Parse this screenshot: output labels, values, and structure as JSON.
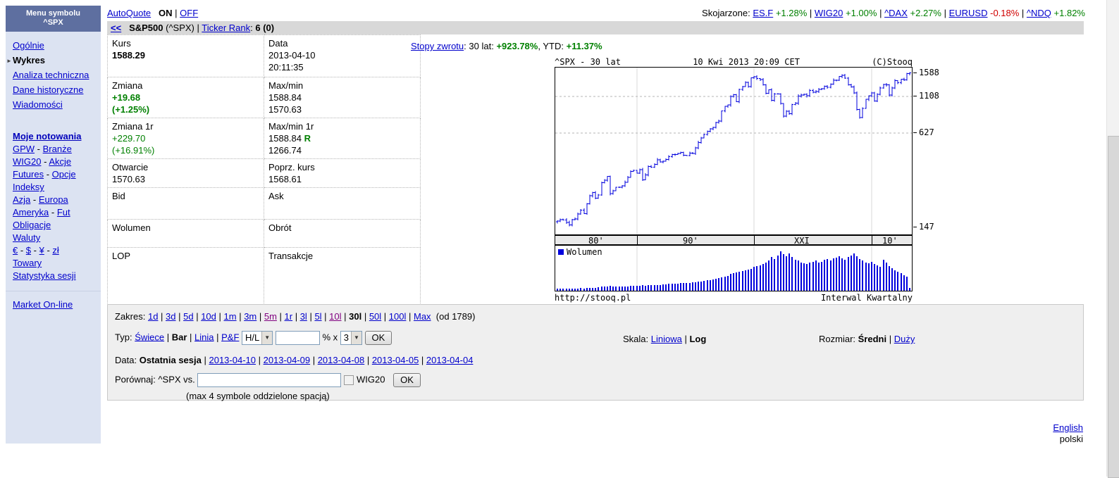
{
  "sidebar": {
    "header_line1": "Menu symbolu",
    "header_line2": "^SPX",
    "top_items": [
      {
        "label": "Ogólnie",
        "state": "link"
      },
      {
        "label": "Wykres",
        "state": "current"
      },
      {
        "label": "Analiza techniczna",
        "state": "link"
      },
      {
        "label": "Dane historyczne",
        "state": "link"
      },
      {
        "label": "Wiadomości",
        "state": "link"
      }
    ],
    "groups": [
      {
        "parts": [
          {
            "t": "Moje notowania",
            "link": true,
            "bold": true
          }
        ]
      },
      {
        "parts": [
          {
            "t": "GPW",
            "link": true
          },
          {
            "t": " - "
          },
          {
            "t": "Branże",
            "link": true
          }
        ]
      },
      {
        "parts": [
          {
            "t": "WIG20",
            "link": true
          },
          {
            "t": " - "
          },
          {
            "t": "Akcje",
            "link": true
          }
        ]
      },
      {
        "parts": [
          {
            "t": "Futures",
            "link": true
          },
          {
            "t": " - "
          },
          {
            "t": "Opcje",
            "link": true
          }
        ]
      },
      {
        "parts": [
          {
            "t": "Indeksy",
            "link": true
          }
        ]
      },
      {
        "parts": [
          {
            "t": "Azja",
            "link": true
          },
          {
            "t": " - "
          },
          {
            "t": "Europa",
            "link": true
          }
        ]
      },
      {
        "parts": [
          {
            "t": "Ameryka",
            "link": true
          },
          {
            "t": " - "
          },
          {
            "t": "Fut",
            "link": true
          }
        ]
      },
      {
        "parts": [
          {
            "t": "Obligacje",
            "link": true
          }
        ]
      },
      {
        "parts": [
          {
            "t": "Waluty",
            "link": true
          }
        ]
      },
      {
        "parts": [
          {
            "t": "€",
            "link": true
          },
          {
            "t": " - "
          },
          {
            "t": "$",
            "link": true
          },
          {
            "t": " - "
          },
          {
            "t": "¥",
            "link": true
          },
          {
            "t": " - "
          },
          {
            "t": "zł",
            "link": true
          }
        ]
      },
      {
        "parts": [
          {
            "t": "Towary",
            "link": true
          }
        ]
      },
      {
        "parts": [
          {
            "t": "Statystyka sesji",
            "link": true
          }
        ]
      }
    ],
    "bottom_item": "Market On-line"
  },
  "topbar": {
    "autoquote_label": "AutoQuote",
    "on_label": "ON",
    "off_label": "OFF",
    "related_label": "Skojarzone:",
    "related": [
      {
        "symbol": "ES.F",
        "change": "+1.28%",
        "direction": "up"
      },
      {
        "symbol": "WIG20",
        "change": "+1.00%",
        "direction": "up"
      },
      {
        "symbol": "^DAX",
        "change": "+2.27%",
        "direction": "up"
      },
      {
        "symbol": "EURUSD",
        "change": "-0.18%",
        "direction": "down"
      },
      {
        "symbol": "^NDQ",
        "change": "+1.82%",
        "direction": "up"
      }
    ]
  },
  "titlebar": {
    "back": "<<",
    "name": "S&P500",
    "code": "(^SPX)",
    "rank_label": "Ticker Rank",
    "rank_value": "6 (0)"
  },
  "quote_table": {
    "kurs": {
      "label": "Kurs",
      "value": "1588.29"
    },
    "data": {
      "label": "Data",
      "line1": "2013-04-10",
      "line2": "20:11:35"
    },
    "zmiana": {
      "label": "Zmiana",
      "line1": "+19.68",
      "line2": "(+1.25%)"
    },
    "maxmin": {
      "label": "Max/min",
      "line1": "1588.84",
      "line2": "1570.63"
    },
    "zmiana1r": {
      "label": "Zmiana 1r",
      "line1": "+229.70",
      "line2": "(+16.91%)"
    },
    "maxmin1r": {
      "label": "Max/min 1r",
      "line1": "1588.84",
      "flag": "R",
      "line2": "1266.74"
    },
    "otwarcie": {
      "label": "Otwarcie",
      "value": "1570.63"
    },
    "poprz": {
      "label": "Poprz. kurs",
      "value": "1568.61"
    },
    "bid": {
      "label": "Bid"
    },
    "ask": {
      "label": "Ask"
    },
    "wolumen": {
      "label": "Wolumen"
    },
    "obrot": {
      "label": "Obrót"
    },
    "lop": {
      "label": "LOP"
    },
    "transakcje": {
      "label": "Transakcje"
    }
  },
  "returns": {
    "link_label": "Stopy zwrotu",
    "period_label": "30 lat:",
    "period_value": "+923.78%",
    "ytd_label": "YTD:",
    "ytd_value": "+11.37%"
  },
  "chart_data": {
    "type": "ohlc-with-volume",
    "title": "^SPX - 30 lat",
    "timestamp": "10 Kwi 2013 20:09 CET",
    "copyright": "(C)Stooq",
    "legend": "Wolumen",
    "source": "http://stooq.pl",
    "interval_label": "Interwal Kwartalny",
    "scale": "log",
    "x_range": [
      "1983Q2",
      "2013Q2"
    ],
    "y_ticks": [
      1588,
      1108,
      627,
      147
    ],
    "ylim": [
      147,
      1650
    ],
    "x_labels": [
      "80'",
      "90'",
      "XXI",
      "10'"
    ],
    "x_label_bar_index": [
      13,
      45,
      83,
      113
    ],
    "decade_gridline_bar_index": [
      27,
      67,
      107
    ],
    "h_gridlines": [
      1108,
      627
    ],
    "quarterly_closes": [
      162,
      166,
      165,
      159,
      153,
      166,
      167,
      181,
      192,
      182,
      211,
      239,
      251,
      231,
      242,
      292,
      304,
      322,
      247,
      259,
      273,
      272,
      278,
      295,
      318,
      349,
      353,
      339,
      358,
      306,
      330,
      375,
      371,
      388,
      417,
      404,
      408,
      418,
      436,
      452,
      451,
      459,
      467,
      446,
      444,
      462,
      459,
      501,
      544,
      584,
      616,
      645,
      671,
      687,
      741,
      757,
      885,
      947,
      970,
      1102,
      1134,
      1017,
      1229,
      1286,
      1373,
      1283,
      1469,
      1499,
      1455,
      1436,
      1320,
      1160,
      1224,
      1041,
      1148,
      1147,
      990,
      815,
      880,
      848,
      975,
      996,
      1112,
      1126,
      1141,
      1115,
      1212,
      1181,
      1191,
      1229,
      1248,
      1295,
      1270,
      1336,
      1418,
      1421,
      1503,
      1527,
      1468,
      1323,
      1280,
      1166,
      903,
      798,
      919,
      1057,
      1115,
      1169,
      1031,
      1141,
      1258,
      1326,
      1321,
      1131,
      1258,
      1408,
      1362,
      1441,
      1426,
      1569,
      1588
    ],
    "volume_rel": [
      0.05,
      0.05,
      0.06,
      0.05,
      0.05,
      0.06,
      0.06,
      0.06,
      0.07,
      0.06,
      0.07,
      0.08,
      0.08,
      0.08,
      0.09,
      0.1,
      0.1,
      0.11,
      0.12,
      0.1,
      0.1,
      0.1,
      0.11,
      0.11,
      0.11,
      0.12,
      0.12,
      0.13,
      0.13,
      0.14,
      0.13,
      0.14,
      0.14,
      0.15,
      0.15,
      0.15,
      0.16,
      0.16,
      0.17,
      0.17,
      0.18,
      0.18,
      0.19,
      0.19,
      0.2,
      0.2,
      0.21,
      0.22,
      0.23,
      0.24,
      0.25,
      0.26,
      0.27,
      0.28,
      0.3,
      0.32,
      0.34,
      0.36,
      0.38,
      0.42,
      0.44,
      0.46,
      0.48,
      0.5,
      0.52,
      0.54,
      0.56,
      0.6,
      0.62,
      0.64,
      0.68,
      0.72,
      0.76,
      0.85,
      0.8,
      0.9,
      1.0,
      0.92,
      0.88,
      0.95,
      0.85,
      0.78,
      0.76,
      0.72,
      0.7,
      0.68,
      0.72,
      0.74,
      0.76,
      0.72,
      0.74,
      0.78,
      0.8,
      0.76,
      0.82,
      0.84,
      0.88,
      0.82,
      0.78,
      0.86,
      0.9,
      0.94,
      0.88,
      0.8,
      0.76,
      0.72,
      0.7,
      0.74,
      0.68,
      0.64,
      0.6,
      0.78,
      0.72,
      0.62,
      0.58,
      0.52,
      0.48,
      0.44,
      0.4,
      0.36,
      0.08
    ]
  },
  "controls": {
    "zakres_label": "Zakres:",
    "zakres_items": [
      {
        "label": "1d",
        "state": "link"
      },
      {
        "label": "3d",
        "state": "link"
      },
      {
        "label": "5d",
        "state": "link"
      },
      {
        "label": "10d",
        "state": "link"
      },
      {
        "label": "1m",
        "state": "link"
      },
      {
        "label": "3m",
        "state": "link"
      },
      {
        "label": "5m",
        "state": "visited"
      },
      {
        "label": "1r",
        "state": "link"
      },
      {
        "label": "3l",
        "state": "link"
      },
      {
        "label": "5l",
        "state": "link"
      },
      {
        "label": "10l",
        "state": "visited"
      },
      {
        "label": "30l",
        "state": "current"
      },
      {
        "label": "50l",
        "state": "link"
      },
      {
        "label": "100l",
        "state": "link"
      },
      {
        "label": "Max",
        "state": "link"
      }
    ],
    "zakres_suffix": "(od 1789)",
    "typ_label": "Typ:",
    "typ_items": [
      {
        "label": "Świece",
        "state": "link"
      },
      {
        "label": "Bar",
        "state": "current"
      },
      {
        "label": "Linia",
        "state": "link"
      },
      {
        "label": "P&F",
        "state": "link"
      }
    ],
    "hl_select_value": "H/L",
    "pct_input_value": "",
    "pct_label": "% x",
    "mult_select_value": "3",
    "ok_label": "OK",
    "skala_label": "Skala:",
    "skala_items": [
      {
        "label": "Liniowa",
        "state": "link"
      },
      {
        "label": "Log",
        "state": "current"
      }
    ],
    "rozmiar_label": "Rozmiar:",
    "rozmiar_items": [
      {
        "label": "Średni",
        "state": "current"
      },
      {
        "label": "Duży",
        "state": "link"
      }
    ],
    "data_label": "Data:",
    "data_current": "Ostatnia sesja",
    "date_links": [
      "2013-04-10",
      "2013-04-09",
      "2013-04-08",
      "2013-04-05",
      "2013-04-04"
    ],
    "compare_label": "Porównaj: ^SPX vs.",
    "compare_input_value": "",
    "compare_checkbox_label": "WIG20",
    "compare_ok_label": "OK",
    "compare_hint": "(max 4 symbole oddzielone spacją)"
  },
  "footer": {
    "english": "English",
    "polski": "polski"
  }
}
